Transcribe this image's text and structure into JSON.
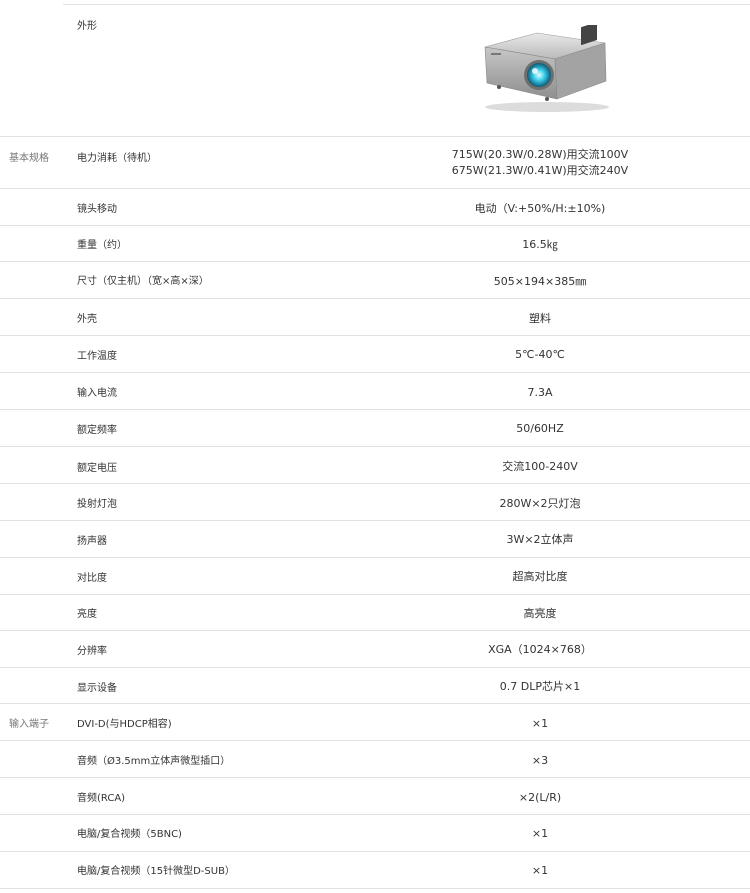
{
  "appearance": {
    "label": "外形",
    "image_icon": "projector-product-image"
  },
  "categories": {
    "basic": "基本规格",
    "input": "输入端子"
  },
  "basic_specs": [
    {
      "label": "电力消耗（待机）",
      "value": [
        "715W(20.3W/0.28W)用交流100V",
        "675W(21.3W/0.41W)用交流240V"
      ]
    },
    {
      "label": "镜头移动",
      "value": [
        "电动（V:+50%/H:±10%)"
      ]
    },
    {
      "label": "重量（约）",
      "value": [
        "16.5㎏"
      ]
    },
    {
      "label": "尺寸（仅主机）（宽×高×深）",
      "value": [
        "505×194×385㎜"
      ]
    },
    {
      "label": "外壳",
      "value": [
        "塑料"
      ]
    },
    {
      "label": "工作温度",
      "value": [
        "5℃-40℃"
      ]
    },
    {
      "label": "输入电流",
      "value": [
        "7.3A"
      ]
    },
    {
      "label": "额定频率",
      "value": [
        "50/60HZ"
      ]
    },
    {
      "label": "额定电压",
      "value": [
        "交流100-240V"
      ]
    },
    {
      "label": "投射灯泡",
      "value": [
        "280W×2只灯泡"
      ]
    },
    {
      "label": "扬声器",
      "value": [
        "3W×2立体声"
      ]
    },
    {
      "label": "对比度",
      "value": [
        "超高对比度"
      ]
    },
    {
      "label": "亮度",
      "value": [
        "高亮度"
      ]
    },
    {
      "label": "分辨率",
      "value": [
        "XGA（1024×768）"
      ]
    },
    {
      "label": "显示设备",
      "value": [
        "0.7 DLP芯片×1"
      ]
    }
  ],
  "input_terminals": [
    {
      "label": "DVI-D(与HDCP相容)",
      "value": [
        "×1"
      ]
    },
    {
      "label": "音频（Ø3.5mm立体声微型插口）",
      "value": [
        "×3"
      ]
    },
    {
      "label": "音频(RCA)",
      "value": [
        "×2(L/R)"
      ]
    },
    {
      "label": "电脑/复合视频（5BNC)",
      "value": [
        "×1"
      ]
    },
    {
      "label": "电脑/复合视频（15针微型D-SUB）",
      "value": [
        "×1"
      ]
    }
  ]
}
